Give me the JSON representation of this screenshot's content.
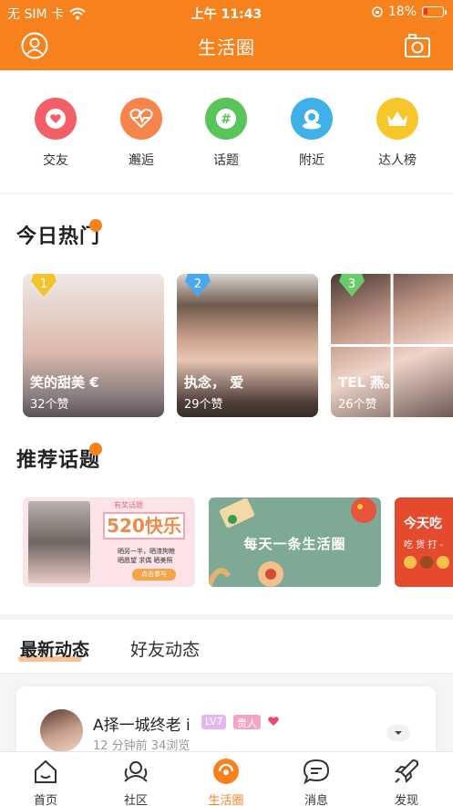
{
  "status": {
    "carrier": "无 SIM 卡",
    "time": "上午 11:43",
    "battery": "18%"
  },
  "nav": {
    "title": "生活圈",
    "left_icon": "user-circle-icon",
    "right_icon": "camera-icon"
  },
  "quick": [
    {
      "label": "交友",
      "icon": "heart-icon",
      "color": "#f25f66"
    },
    {
      "label": "邂逅",
      "icon": "heartbeat-icon",
      "color": "#f7844a"
    },
    {
      "label": "话题",
      "icon": "hashtag-icon",
      "color": "#57c55a"
    },
    {
      "label": "附近",
      "icon": "location-icon",
      "color": "#3eb1e8"
    },
    {
      "label": "达人榜",
      "icon": "crown-icon",
      "color": "#f7c62a"
    }
  ],
  "hot": {
    "title": "今日热门",
    "cards": [
      {
        "rank": "1",
        "name": "笑的甜美 €",
        "likes": "32个赞"
      },
      {
        "rank": "2",
        "name": "执念， 爱",
        "likes": "29个赞"
      },
      {
        "rank": "3",
        "name": "TEL 燕。",
        "likes": "26个赞"
      }
    ]
  },
  "topics": {
    "title": "推荐话题",
    "cards": [
      {
        "title": "有奖话题",
        "headline": "520快乐",
        "text1": "晒另一半，晒渣狗粮",
        "text2": "晒愿望  求偶  晒美照",
        "cta": "点击参与"
      },
      {
        "headline": "每天一条生活圈"
      },
      {
        "headline": "今天吃",
        "sub": "吃 货 打 -"
      }
    ]
  },
  "tabs": {
    "active": "最新动态",
    "other": "好友动态"
  },
  "post": {
    "name": "A择一城终老 i",
    "level": "LV7",
    "tag": "贵人",
    "meta": "12 分钟前  34浏览"
  },
  "tabbar": [
    {
      "label": "首页",
      "icon": "home-icon"
    },
    {
      "label": "社区",
      "icon": "community-icon"
    },
    {
      "label": "生活圈",
      "icon": "life-circle-icon",
      "active": true
    },
    {
      "label": "消息",
      "icon": "message-icon"
    },
    {
      "label": "发现",
      "icon": "rocket-icon"
    }
  ]
}
